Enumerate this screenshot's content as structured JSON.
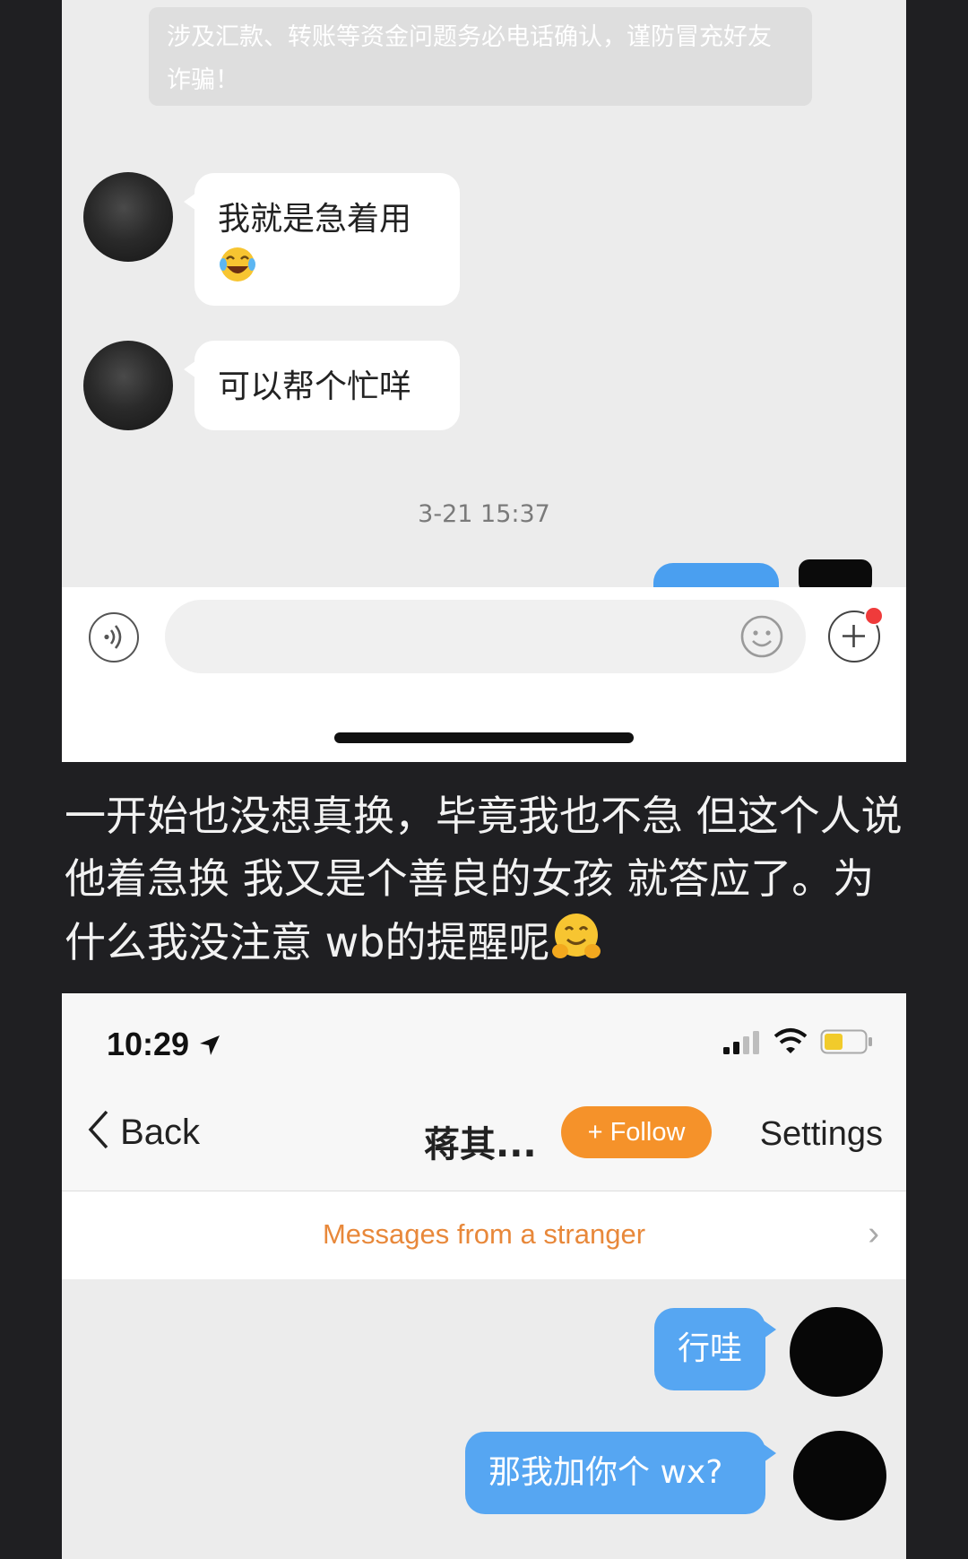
{
  "top_screenshot": {
    "notice": "涉及汇款、转账等资金问题务必电话确认，谨防冒充好友诈骗！",
    "messages": [
      {
        "text": "我就是急着用",
        "emoji": "😂"
      },
      {
        "text": "可以帮个忙咩"
      }
    ],
    "timestamp": "3-21 15:37"
  },
  "caption": {
    "text": "一开始也没想真换，毕竟我也不急 但这个人说他着急换 我又是个善良的女孩 就答应了。为什么我没注意 wb的提醒呢",
    "emoji": "🤗"
  },
  "bottom_screenshot": {
    "status": {
      "time": "10:29"
    },
    "nav": {
      "back_label": "Back",
      "title": "蒋其...",
      "follow_label": "+ Follow",
      "settings_label": "Settings"
    },
    "stranger_banner": "Messages from a stranger",
    "messages": [
      {
        "text": "行哇"
      },
      {
        "text": "那我加你个 wx?"
      }
    ]
  },
  "colors": {
    "page_background": "#1f1f22",
    "chat_background": "#ececec",
    "outgoing_bubble": "#56a6f2",
    "follow_button": "#f5922a",
    "stranger_text": "#e8883a"
  }
}
